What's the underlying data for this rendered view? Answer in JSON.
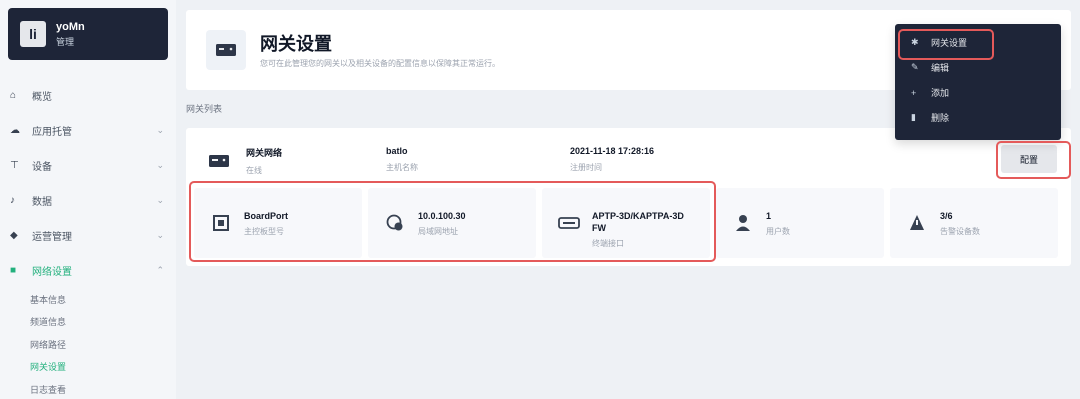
{
  "brand": {
    "logo": "li",
    "user": "yoMn",
    "role": "管理"
  },
  "sidebar": {
    "items": [
      {
        "icon": "home-icon",
        "glyph": "⌂",
        "label": "概览",
        "chevron": ""
      },
      {
        "icon": "cloud-icon",
        "glyph": "☁",
        "label": "应用托管",
        "chevron": "⌄"
      },
      {
        "icon": "plug-icon",
        "glyph": "⊤",
        "label": "设备",
        "chevron": "⌄"
      },
      {
        "icon": "chart-icon",
        "glyph": "♪",
        "label": "数据",
        "chevron": "⌄"
      },
      {
        "icon": "user-icon",
        "glyph": "◆",
        "label": "运营管理",
        "chevron": "⌄"
      },
      {
        "icon": "gateway-icon",
        "glyph": "■",
        "label": "网络设置",
        "chevron": "⌃",
        "active": true
      }
    ],
    "sub_items": [
      {
        "label": "基本信息",
        "active": false
      },
      {
        "label": "频道信息",
        "active": false
      },
      {
        "label": "网络路径",
        "active": false
      },
      {
        "label": "网关设置",
        "active": true
      },
      {
        "label": "日志查看",
        "active": false
      }
    ]
  },
  "header": {
    "title": "网关设置",
    "description": "您可在此管理您的网关以及相关设备的配置信息以保障其正常运行。"
  },
  "section_label": "网关列表",
  "gateway": {
    "info": [
      {
        "main": "网关网络",
        "sub": "在线"
      },
      {
        "main": "batlo",
        "sub": "主机名称"
      },
      {
        "main": "2021-11-18 17:28:16",
        "sub": "注册时间"
      }
    ],
    "edit_label": "配置",
    "props": [
      {
        "icon": "chip-icon",
        "glyph": "▣",
        "main": "BoardPort",
        "sub": "主控板型号"
      },
      {
        "icon": "wifi-globe-icon",
        "glyph": "◍",
        "main": "10.0.100.30",
        "sub": "局域网地址"
      },
      {
        "icon": "router-icon",
        "glyph": "▭",
        "main": "APTP-3D/KAPTPA-3D",
        "main2": "FW",
        "sub": "终端接口"
      },
      {
        "icon": "person-icon",
        "glyph": "☗",
        "main": "1",
        "sub": "用户数"
      },
      {
        "icon": "warning-icon",
        "glyph": "▲",
        "main": "3/6",
        "sub": "告警设备数"
      }
    ]
  },
  "menu": {
    "items": [
      {
        "icon": "settings-icon",
        "glyph": "✱",
        "label": "网关设置"
      },
      {
        "icon": "edit-icon",
        "glyph": "✎",
        "label": "编辑"
      },
      {
        "icon": "plus-icon",
        "glyph": "+",
        "label": "添加"
      },
      {
        "icon": "trash-icon",
        "glyph": "▮",
        "label": "删除"
      }
    ]
  },
  "colors": {
    "accent": "#22b07d",
    "highlight": "#e45a5a",
    "dark": "#1e2538"
  }
}
